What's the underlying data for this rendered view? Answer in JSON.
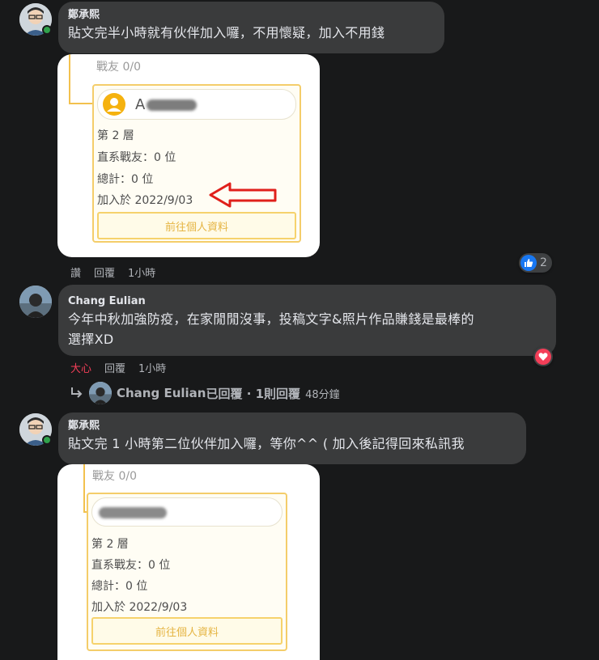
{
  "comment1": {
    "author": "鄭承熙",
    "text": "貼文完半小時就有伙伴加入囉，不用懷疑，加入不用錢",
    "card": {
      "header": "戰友 0/0",
      "name_partial": "A",
      "layer": "第 2 層",
      "direct": "直系戰友：0 位",
      "total": "總計：0 位",
      "joined": "加入於 2022/9/03",
      "profile_button": "前往個人資料"
    },
    "actions": {
      "like": "讚",
      "reply": "回覆",
      "time": "1小時"
    },
    "reactions": {
      "icon": "like-icon",
      "count": "2",
      "color": "#1877f2"
    }
  },
  "comment2": {
    "author": "Chang Eulian",
    "text_line1": "今年中秋加強防疫，在家閒閒沒事，投稿文字&照片作品賺錢是最棒的",
    "text_line2": "選擇XD",
    "actions": {
      "like": "大心",
      "reply": "回覆",
      "time": "1小時"
    },
    "reactions": {
      "icon": "heart-icon",
      "color": "#f33e58"
    },
    "replies": {
      "author": "Chang Eulian",
      "suffix": "已回覆 · 1則回覆",
      "time": "48分鐘"
    }
  },
  "comment3": {
    "author": "鄭承熙",
    "text": "貼文完 1 小時第二位伙伴加入囉，等你^^ ( 加入後記得回來私訊我",
    "card": {
      "header": "戰友 0/0",
      "layer": "第 2 層",
      "direct": "直系戰友：0 位",
      "total": "總計：0 位",
      "joined": "加入於 2022/9/03",
      "profile_button": "前往個人資料"
    }
  }
}
